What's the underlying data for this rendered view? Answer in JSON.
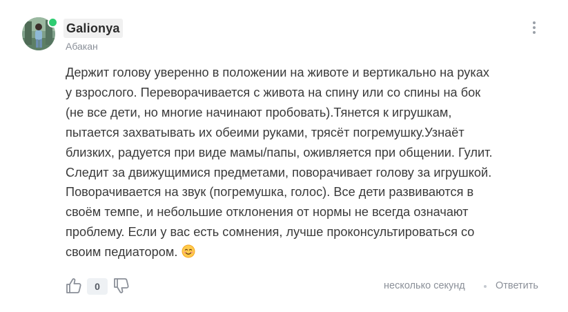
{
  "comment": {
    "author": "Galionya",
    "city": "Абакан",
    "online_color": "#2ecc71",
    "text_lines": [
      "Держит голову уверенно в положении на животе и вертикально на руках",
      "у взрослого. Переворачивается с живота на спину или со спины на бок",
      "(не все дети, но многие начинают пробовать).Тянется к игрушкам,",
      "пытается захватывать их обеими руками, трясёт погремушку.Узнаёт",
      "близких, радуется при виде мамы/папы, оживляется при общении. Гулит.",
      "Следит за движущимися предметами, поворачивает голову за игрушкой.",
      "Поворачивается на звук (погремушка, голос). Все дети развиваются в",
      "своём темпе, и небольшие отклонения от нормы не всегда означают",
      "проблему. Если у вас есть сомнения, лучше проконсультироваться со",
      "своим педиатором."
    ],
    "emoji": "smiling-face-emoji",
    "rating": "0",
    "time": "несколько секунд",
    "reply_label": "Ответить",
    "icons": {
      "more": "more-vertical-icon",
      "like": "thumbs-up-icon",
      "dislike": "thumbs-down-icon"
    }
  }
}
